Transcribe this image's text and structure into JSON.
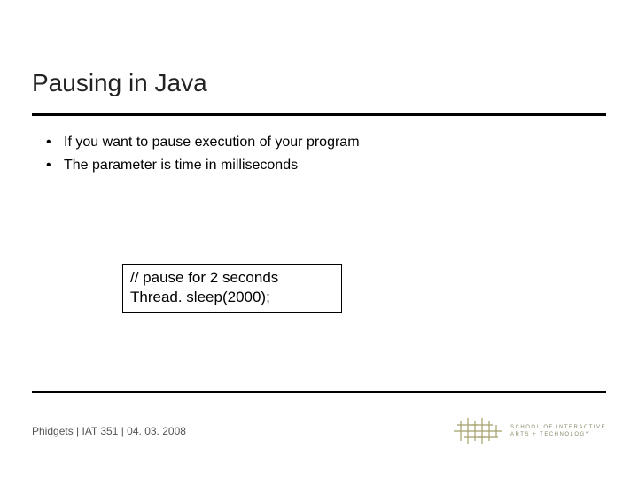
{
  "title": "Pausing in Java",
  "bullets": [
    "If you want to pause execution of your program",
    "The parameter is time in milliseconds"
  ],
  "code": {
    "line1": "// pause for 2 seconds",
    "line2": "Thread. sleep(2000);"
  },
  "footer": "Phidgets  |  IAT 351  |  04. 03. 2008",
  "logo_text": {
    "line1": "SCHOOL OF INTERACTIVE",
    "line2": "ARTS + TECHNOLOGY"
  }
}
